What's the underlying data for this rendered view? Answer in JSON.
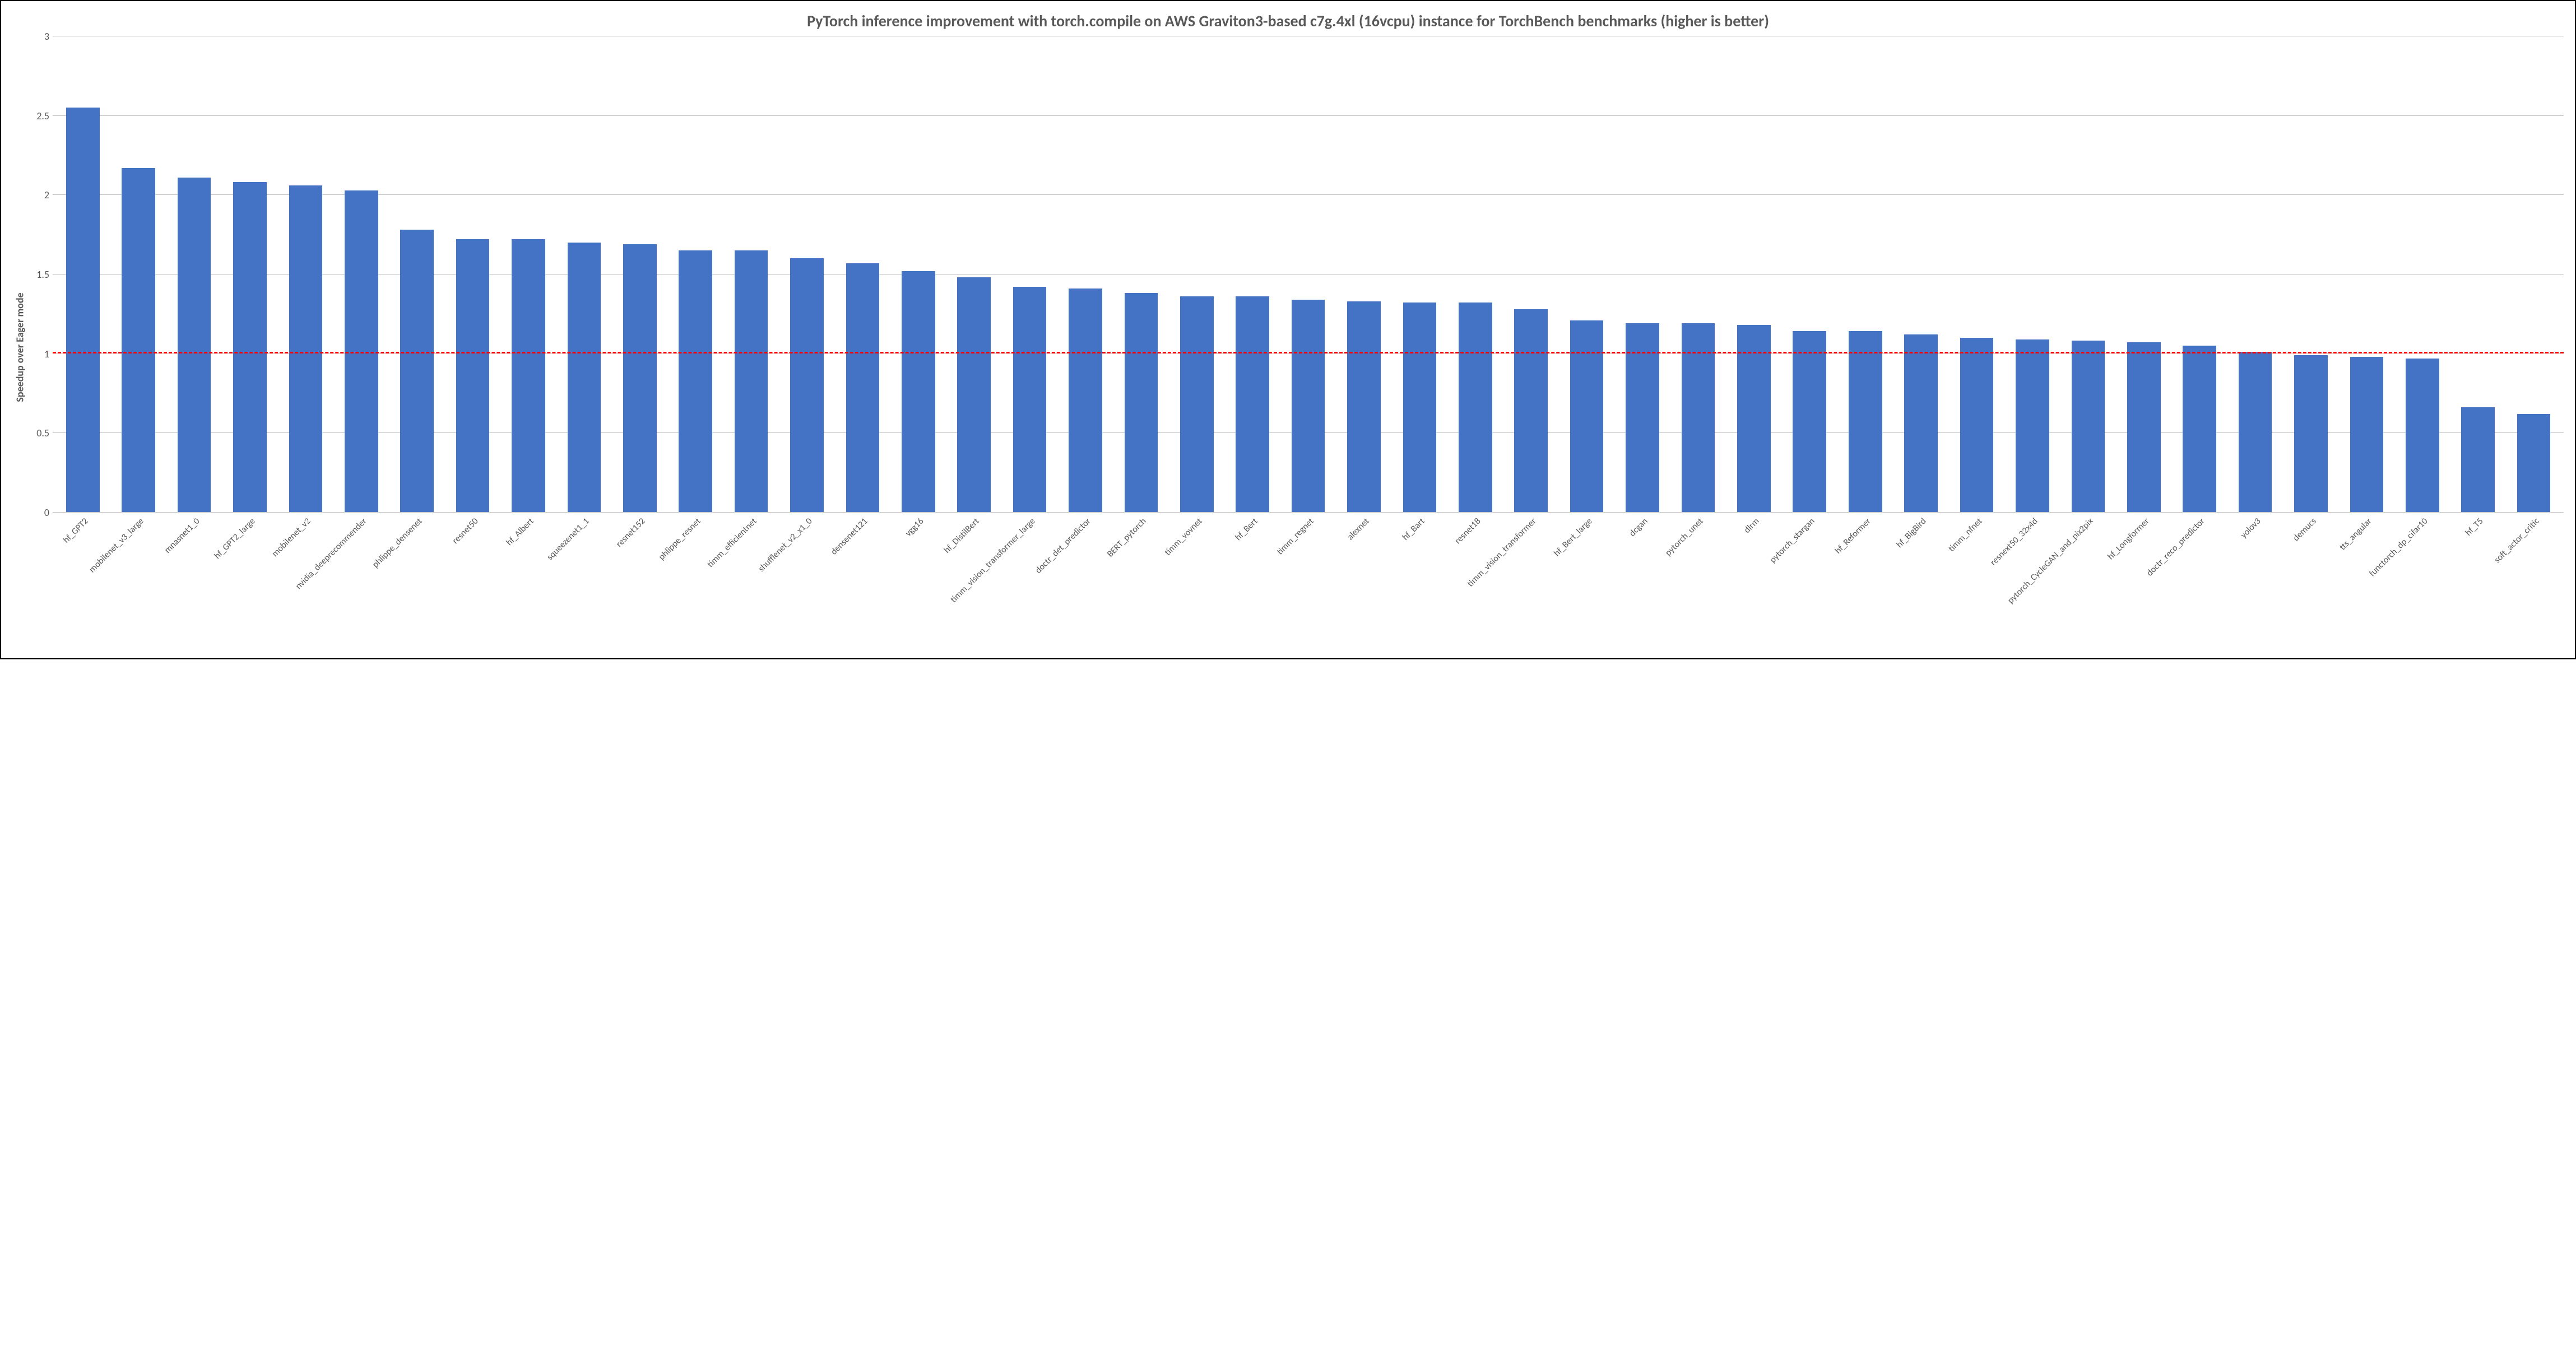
{
  "chart_data": {
    "type": "bar",
    "title": "PyTorch inference improvement with torch.compile on AWS Graviton3-based c7g.4xl (16vcpu) instance for TorchBench benchmarks\n(higher is better)",
    "ylabel": "Speedup over Eager mode",
    "xlabel": "",
    "ylim": [
      0,
      3
    ],
    "yticks": [
      0,
      0.5,
      1,
      1.5,
      2,
      2.5,
      3
    ],
    "reference_line": 1.0,
    "bar_color": "#4472C4",
    "categories": [
      "hf_GPT2",
      "mobilenet_v3_large",
      "mnasnet1_0",
      "hf_GPT2_large",
      "mobilenet_v2",
      "nvidia_deeprecommender",
      "phlippe_densenet",
      "resnet50",
      "hf_Albert",
      "squeezenet1_1",
      "resnet152",
      "phlippe_resnet",
      "timm_efficientnet",
      "shufflenet_v2_x1_0",
      "densenet121",
      "vgg16",
      "hf_DistilBert",
      "timm_vision_transformer_large",
      "doctr_det_predictor",
      "BERT_pytorch",
      "timm_vovnet",
      "hf_Bert",
      "timm_regnet",
      "alexnet",
      "hf_Bart",
      "resnet18",
      "timm_vision_transformer",
      "hf_Bert_large",
      "dcgan",
      "pytorch_unet",
      "dlrm",
      "pytorch_stargan",
      "hf_Reformer",
      "hf_BigBird",
      "timm_nfnet",
      "resnext50_32x4d",
      "pytorch_CycleGAN_and_pix2pix",
      "hf_Longformer",
      "doctr_reco_predictor",
      "yolov3",
      "demucs",
      "tts_angular",
      "functorch_dp_cifar10",
      "hf_T5",
      "soft_actor_critic"
    ],
    "values": [
      2.55,
      2.17,
      2.11,
      2.08,
      2.06,
      2.03,
      1.78,
      1.72,
      1.72,
      1.7,
      1.69,
      1.65,
      1.65,
      1.6,
      1.57,
      1.52,
      1.48,
      1.42,
      1.41,
      1.38,
      1.36,
      1.36,
      1.34,
      1.33,
      1.32,
      1.32,
      1.28,
      1.21,
      1.19,
      1.19,
      1.18,
      1.14,
      1.14,
      1.12,
      1.1,
      1.09,
      1.08,
      1.07,
      1.05,
      1.01,
      0.99,
      0.98,
      0.97,
      0.66,
      0.62
    ]
  }
}
